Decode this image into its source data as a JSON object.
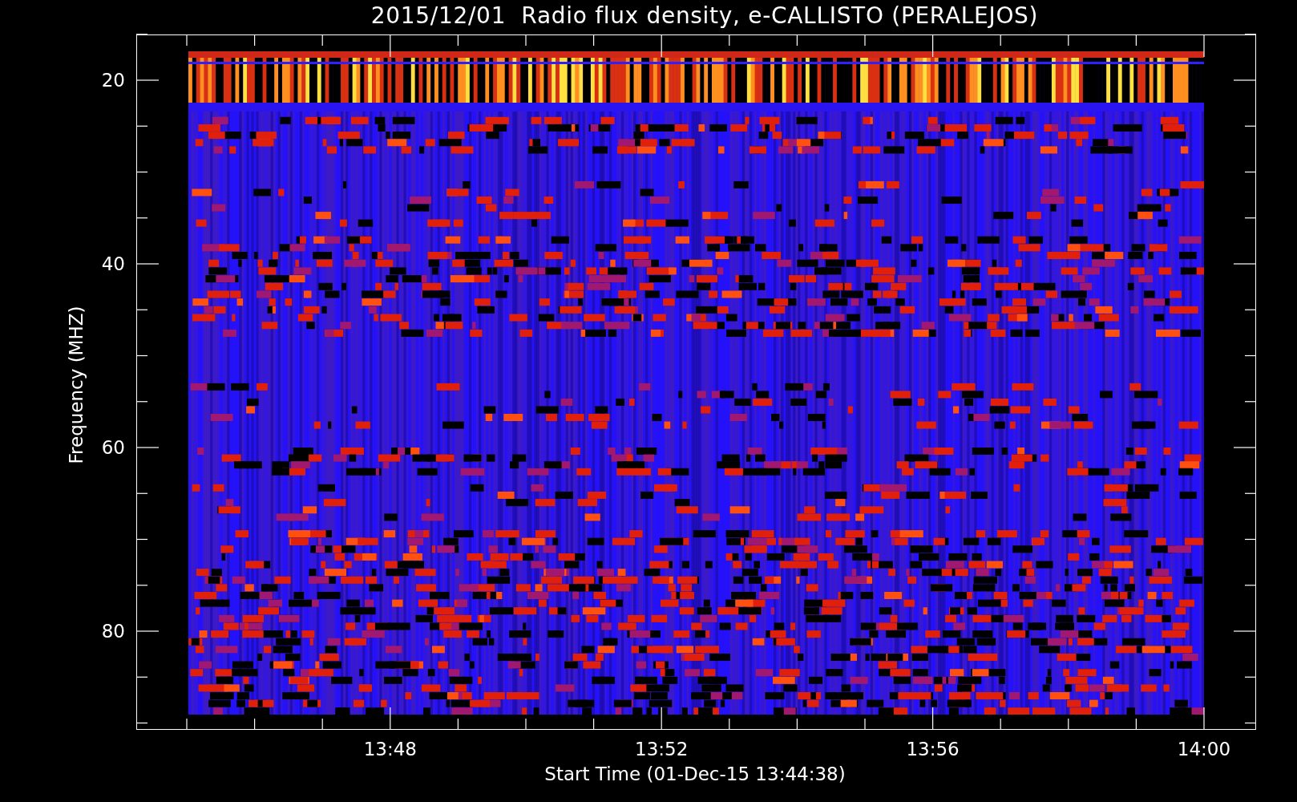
{
  "title": "2015/12/01  Radio flux density, e-CALLISTO (PERALEJOS)",
  "y_axis": {
    "label": "Frequency (MHZ)",
    "ticks": [
      "20",
      "40",
      "60",
      "80"
    ]
  },
  "x_axis": {
    "label": "Start Time (01-Dec-15 13:44:38)",
    "ticks": [
      "13:48",
      "13:52",
      "13:56",
      "14:00"
    ]
  }
}
